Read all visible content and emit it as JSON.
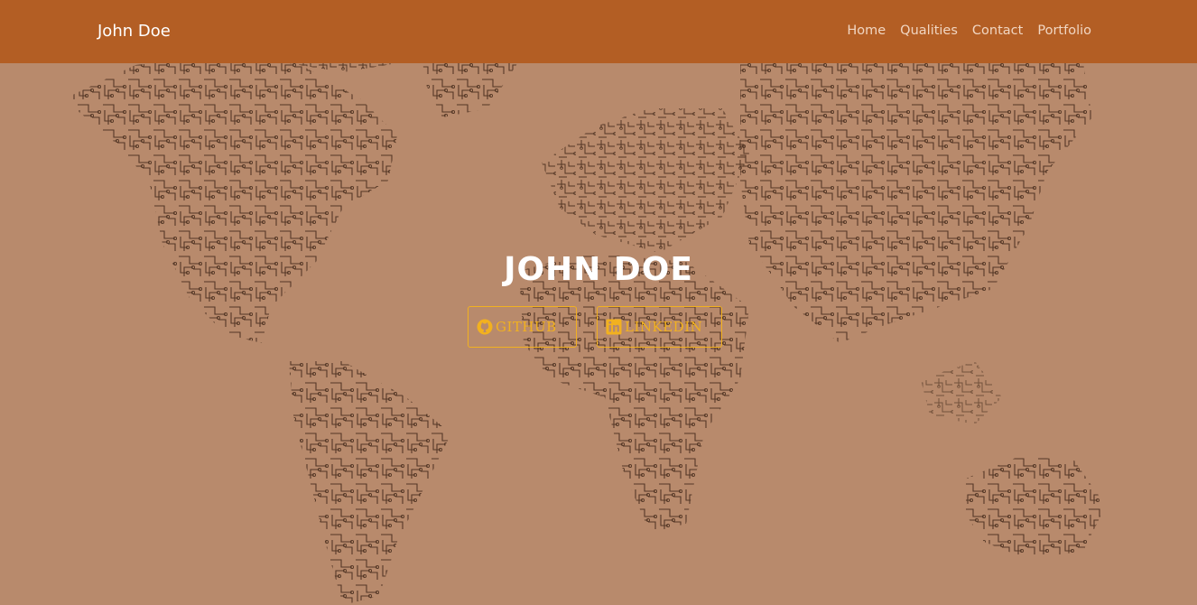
{
  "navbar": {
    "brand": "John Doe",
    "links": [
      "Home",
      "Qualities",
      "Contact",
      "Portfolio"
    ]
  },
  "hero": {
    "title": "JOHN DOE",
    "buttons": [
      {
        "label": "GITHUB",
        "icon": "github-icon"
      },
      {
        "label": "LINKEDIN",
        "icon": "linkedin-icon"
      }
    ]
  },
  "colors": {
    "background": "#b88a6c",
    "navbar": "#b35e24",
    "accent": "#f2b11f",
    "circuit": "#5a3a26"
  }
}
